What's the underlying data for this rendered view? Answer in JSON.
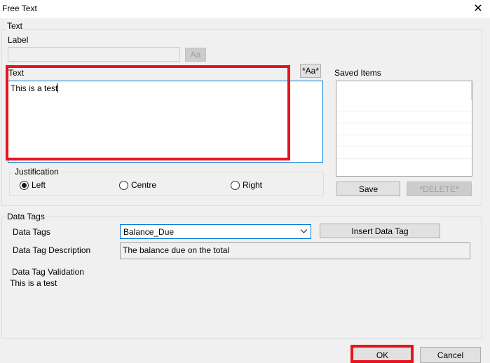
{
  "window": {
    "title": "Free Text",
    "close_glyph": "✕"
  },
  "text_group": {
    "legend": "Text",
    "label_caption": "Label",
    "label_value": "",
    "font_button": "Aa",
    "text_caption": "Text",
    "text_font_button": "*Aa*",
    "text_value": "This is a test"
  },
  "saved_items": {
    "caption": "Saved Items",
    "save_button": "Save",
    "delete_button": "*DELETE*"
  },
  "justification": {
    "legend": "Justification",
    "options": [
      "Left",
      "Centre",
      "Right"
    ],
    "selected": "Left"
  },
  "data_tags": {
    "legend": "Data Tags",
    "tags_label": "Data Tags",
    "selected_tag": "Balance_Due",
    "insert_button": "Insert Data Tag",
    "description_label": "Data Tag Description",
    "description_value": "The balance due on the total",
    "validation_label": "Data Tag Validation",
    "validation_value": "This is a test"
  },
  "footer": {
    "ok_button": "OK",
    "cancel_button": "Cancel"
  },
  "colors": {
    "highlight_red": "#e8141c",
    "focus_blue": "#0078d7",
    "dialog_bg": "#f0f0f0"
  }
}
